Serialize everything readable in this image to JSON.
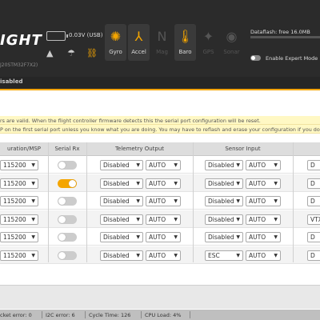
{
  "header": {
    "logo": "IGHT",
    "logo_sub": "J20STM32F7X2)",
    "battery": "0.03V (USB)",
    "sensors": [
      {
        "label": "Gyro",
        "icon": "gyro-icon",
        "glyph": "✺",
        "active": true
      },
      {
        "label": "Accel",
        "icon": "accel-icon",
        "glyph": "⅄",
        "active": true
      },
      {
        "label": "Mag",
        "icon": "mag-icon",
        "glyph": "N",
        "active": false
      },
      {
        "label": "Baro",
        "icon": "baro-icon",
        "glyph": "🌡",
        "active": true
      },
      {
        "label": "GPS",
        "icon": "gps-icon",
        "glyph": "✦",
        "active": false
      },
      {
        "label": "Sonar",
        "icon": "sonar-icon",
        "glyph": "◉",
        "active": false
      }
    ],
    "dataflash": "Dataflash: free 16.0MB",
    "expert_mode": "Enable Expert Mode",
    "status": "isabled"
  },
  "notes": [
    "rs are valid. When the flight controller firmware detects this the serial port configuration will be reset.",
    "P on the first serial port unless you know what you are doing. You may have to reflash and erase your configuration if you do."
  ],
  "table": {
    "headers": [
      "uration/MSP",
      "Serial Rx",
      "Telemetry Output",
      "Sensor Input"
    ],
    "rows": [
      {
        "msp": "115200",
        "rx": false,
        "tel": "Disabled",
        "tel_baud": "AUTO",
        "sensor": "Disabled",
        "sensor_baud": "AUTO",
        "peri": "D"
      },
      {
        "msp": "115200",
        "rx": true,
        "tel": "Disabled",
        "tel_baud": "AUTO",
        "sensor": "Disabled",
        "sensor_baud": "AUTO",
        "peri": "D"
      },
      {
        "msp": "115200",
        "rx": false,
        "tel": "Disabled",
        "tel_baud": "AUTO",
        "sensor": "Disabled",
        "sensor_baud": "AUTO",
        "peri": "D"
      },
      {
        "msp": "115200",
        "rx": false,
        "tel": "Disabled",
        "tel_baud": "AUTO",
        "sensor": "Disabled",
        "sensor_baud": "AUTO",
        "peri": "VTX"
      },
      {
        "msp": "115200",
        "rx": false,
        "tel": "Disabled",
        "tel_baud": "AUTO",
        "sensor": "Disabled",
        "sensor_baud": "AUTO",
        "peri": "D"
      },
      {
        "msp": "115200",
        "rx": false,
        "tel": "Disabled",
        "tel_baud": "AUTO",
        "sensor": "ESC",
        "sensor_baud": "AUTO",
        "peri": "D"
      }
    ]
  },
  "statusbar": [
    "cket error: 0",
    "I2C error: 6",
    "Cycle Time: 126",
    "CPU Load: 4%"
  ],
  "colors": {
    "accent": "#f4a500",
    "header_bg": "#2b2b2b",
    "note_bg": "#fff8c4"
  }
}
